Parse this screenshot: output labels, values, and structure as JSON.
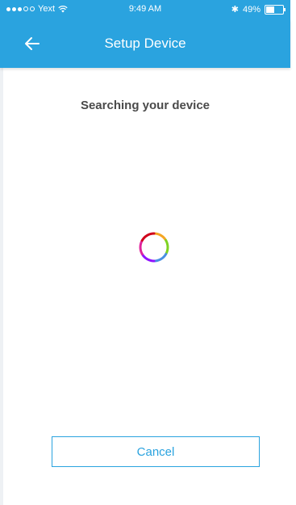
{
  "status_bar": {
    "carrier": "Yext",
    "time": "9:49 AM",
    "battery_percent": "49%",
    "battery_level": 0.49,
    "signal_bars_filled": 3,
    "signal_bars_total": 5
  },
  "header": {
    "title": "Setup Device",
    "back_icon": "arrow-left-icon"
  },
  "main": {
    "heading": "Searching your device",
    "spinner_icon": "loading-spinner-icon"
  },
  "footer": {
    "cancel_label": "Cancel"
  },
  "colors": {
    "accent": "#2aa3df",
    "text": "#4a4a4a",
    "background": "#ffffff"
  }
}
